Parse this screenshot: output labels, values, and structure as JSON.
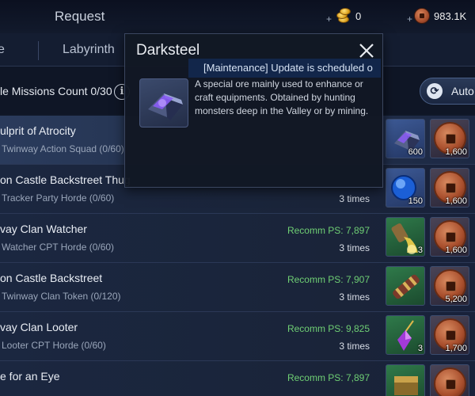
{
  "topbar": {
    "title": "Request",
    "gold": {
      "plus": "+",
      "value": "0",
      "icon": "gold-coins-icon"
    },
    "currency": {
      "plus": "+",
      "value": "983.1K",
      "icon": "copper-coin-icon"
    }
  },
  "tabs": [
    {
      "label": "e"
    },
    {
      "label": "Labyrinth"
    }
  ],
  "missions_count": "le Missions Count 0/30",
  "info_label": "i",
  "auto_button": {
    "label": "Auto",
    "icon": "refresh-icon"
  },
  "ticker": "[Maintenance] Update is scheduled o",
  "popup": {
    "title": "Darksteel",
    "description": "A special ore mainly used to enhance or craft equipments. Obtained by hunting monsters deep in the Valley or by mining.",
    "icon": "darksteel-ore-icon"
  },
  "missions": [
    {
      "title": "ulprit of Atrocity",
      "subtitle": "Twinway Action Squad (0/60)",
      "recomm": "",
      "times": "",
      "reward_a": {
        "icon": "darksteel-ore-icon",
        "qty": "600",
        "bg": "blue"
      },
      "reward_b": {
        "icon": "copper-coin-icon",
        "qty": "1,600"
      }
    },
    {
      "title": "on Castle Backstreet Thug",
      "subtitle": "Tracker Party Horde (0/60)",
      "recomm": "",
      "times": "3 times",
      "reward_a": {
        "icon": "blue-orb-icon",
        "qty": "150",
        "bg": "blue"
      },
      "reward_b": {
        "icon": "copper-coin-icon",
        "qty": "1,600"
      }
    },
    {
      "title": "vay Clan Watcher",
      "subtitle": "Watcher CPT Horde (0/60)",
      "recomm": "Recomm PS: 7,897",
      "times": "3 times",
      "reward_a": {
        "icon": "potion-pour-icon",
        "qty": "3",
        "bg": "green"
      },
      "reward_b": {
        "icon": "copper-coin-icon",
        "qty": "1,600"
      }
    },
    {
      "title": "on Castle Backstreet",
      "subtitle": "Twinway Clan Token (0/120)",
      "recomm": "Recomm PS: 7,907",
      "times": "3 times",
      "reward_a": {
        "icon": "scroll-icon",
        "qty": "",
        "bg": "green"
      },
      "reward_b": {
        "icon": "copper-coin-icon",
        "qty": "5,200"
      }
    },
    {
      "title": "vay Clan Looter",
      "subtitle": "Looter CPT Horde (0/60)",
      "recomm": "Recomm PS: 9,825",
      "times": "3 times",
      "reward_a": {
        "icon": "purple-gem-pendant-icon",
        "qty": "3",
        "bg": "green"
      },
      "reward_b": {
        "icon": "copper-coin-icon",
        "qty": "1,700"
      }
    },
    {
      "title": "e for an Eye",
      "subtitle": "",
      "recomm": "Recomm PS: 7,897",
      "times": "",
      "reward_a": {
        "icon": "chest-icon",
        "qty": "",
        "bg": "green"
      },
      "reward_b": {
        "icon": "copper-coin-icon",
        "qty": ""
      }
    }
  ]
}
